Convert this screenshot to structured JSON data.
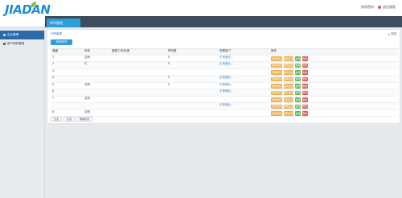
{
  "logo": {
    "text": "JIADAN",
    "sub": ""
  },
  "header": {
    "link_password": "修改密码",
    "link_logout": "退出管理"
  },
  "sidebar": {
    "items": [
      {
        "label": "企业管理",
        "active": true
      },
      {
        "label": "用户资料管理",
        "active": false
      }
    ]
  },
  "tabs": [
    {
      "label": "呼叫管理"
    },
    {
      "label": ""
    }
  ],
  "main": {
    "breadcrumb": "列表管理",
    "close_label": "关闭",
    "add_button": "添加呼叫"
  },
  "table": {
    "headers": [
      "通道",
      "状态",
      "客服工号/坐席",
      "呼叫数",
      "所属部门",
      "操作"
    ],
    "rows": [
      {
        "c0": "1",
        "c1": "空闲",
        "c2": "",
        "c3": "0",
        "c4": "正常营业...",
        "shade": false
      },
      {
        "c0": "2",
        "c1": "忙",
        "c2": "",
        "c3": "0",
        "c4": "正常营业...",
        "shade": true
      },
      {
        "c0": "3",
        "c1": "",
        "c2": "",
        "c3": "",
        "c4": "",
        "shade": false
      },
      {
        "c0": "4",
        "c1": "",
        "c2": "",
        "c3": "0",
        "c4": "正常营业...",
        "shade": true
      },
      {
        "c0": "5",
        "c1": "空闲",
        "c2": "",
        "c3": "0",
        "c4": "正常营业...",
        "shade": false
      },
      {
        "c0": "6",
        "c1": "",
        "c2": "",
        "c3": "",
        "c4": "正常营业...",
        "shade": true
      },
      {
        "c0": "7",
        "c1": "空闲",
        "c2": "",
        "c3": "",
        "c4": "",
        "shade": false
      },
      {
        "c0": "",
        "c1": "",
        "c2": "",
        "c3": "",
        "c4": "正常营业...",
        "shade": true
      },
      {
        "c0": "8",
        "c1": "空闲",
        "c2": "",
        "c3": "",
        "c4": "",
        "shade": false
      }
    ],
    "actions": [
      "查看详情",
      "编辑设置",
      "启用",
      "删除"
    ]
  },
  "footer": {
    "buttons": [
      "全选",
      "反选",
      "删除所选"
    ]
  },
  "colors": {
    "accent": "#2f9bd8",
    "tabbar": "#3e4d5e",
    "warning": "#f0ad4e",
    "success": "#5cb85c",
    "danger": "#d9534f"
  },
  "icons": {
    "logo": "leaf-icon",
    "close": "close-icon",
    "side_bullet": "circle-icon",
    "notice": "dot-icon"
  }
}
